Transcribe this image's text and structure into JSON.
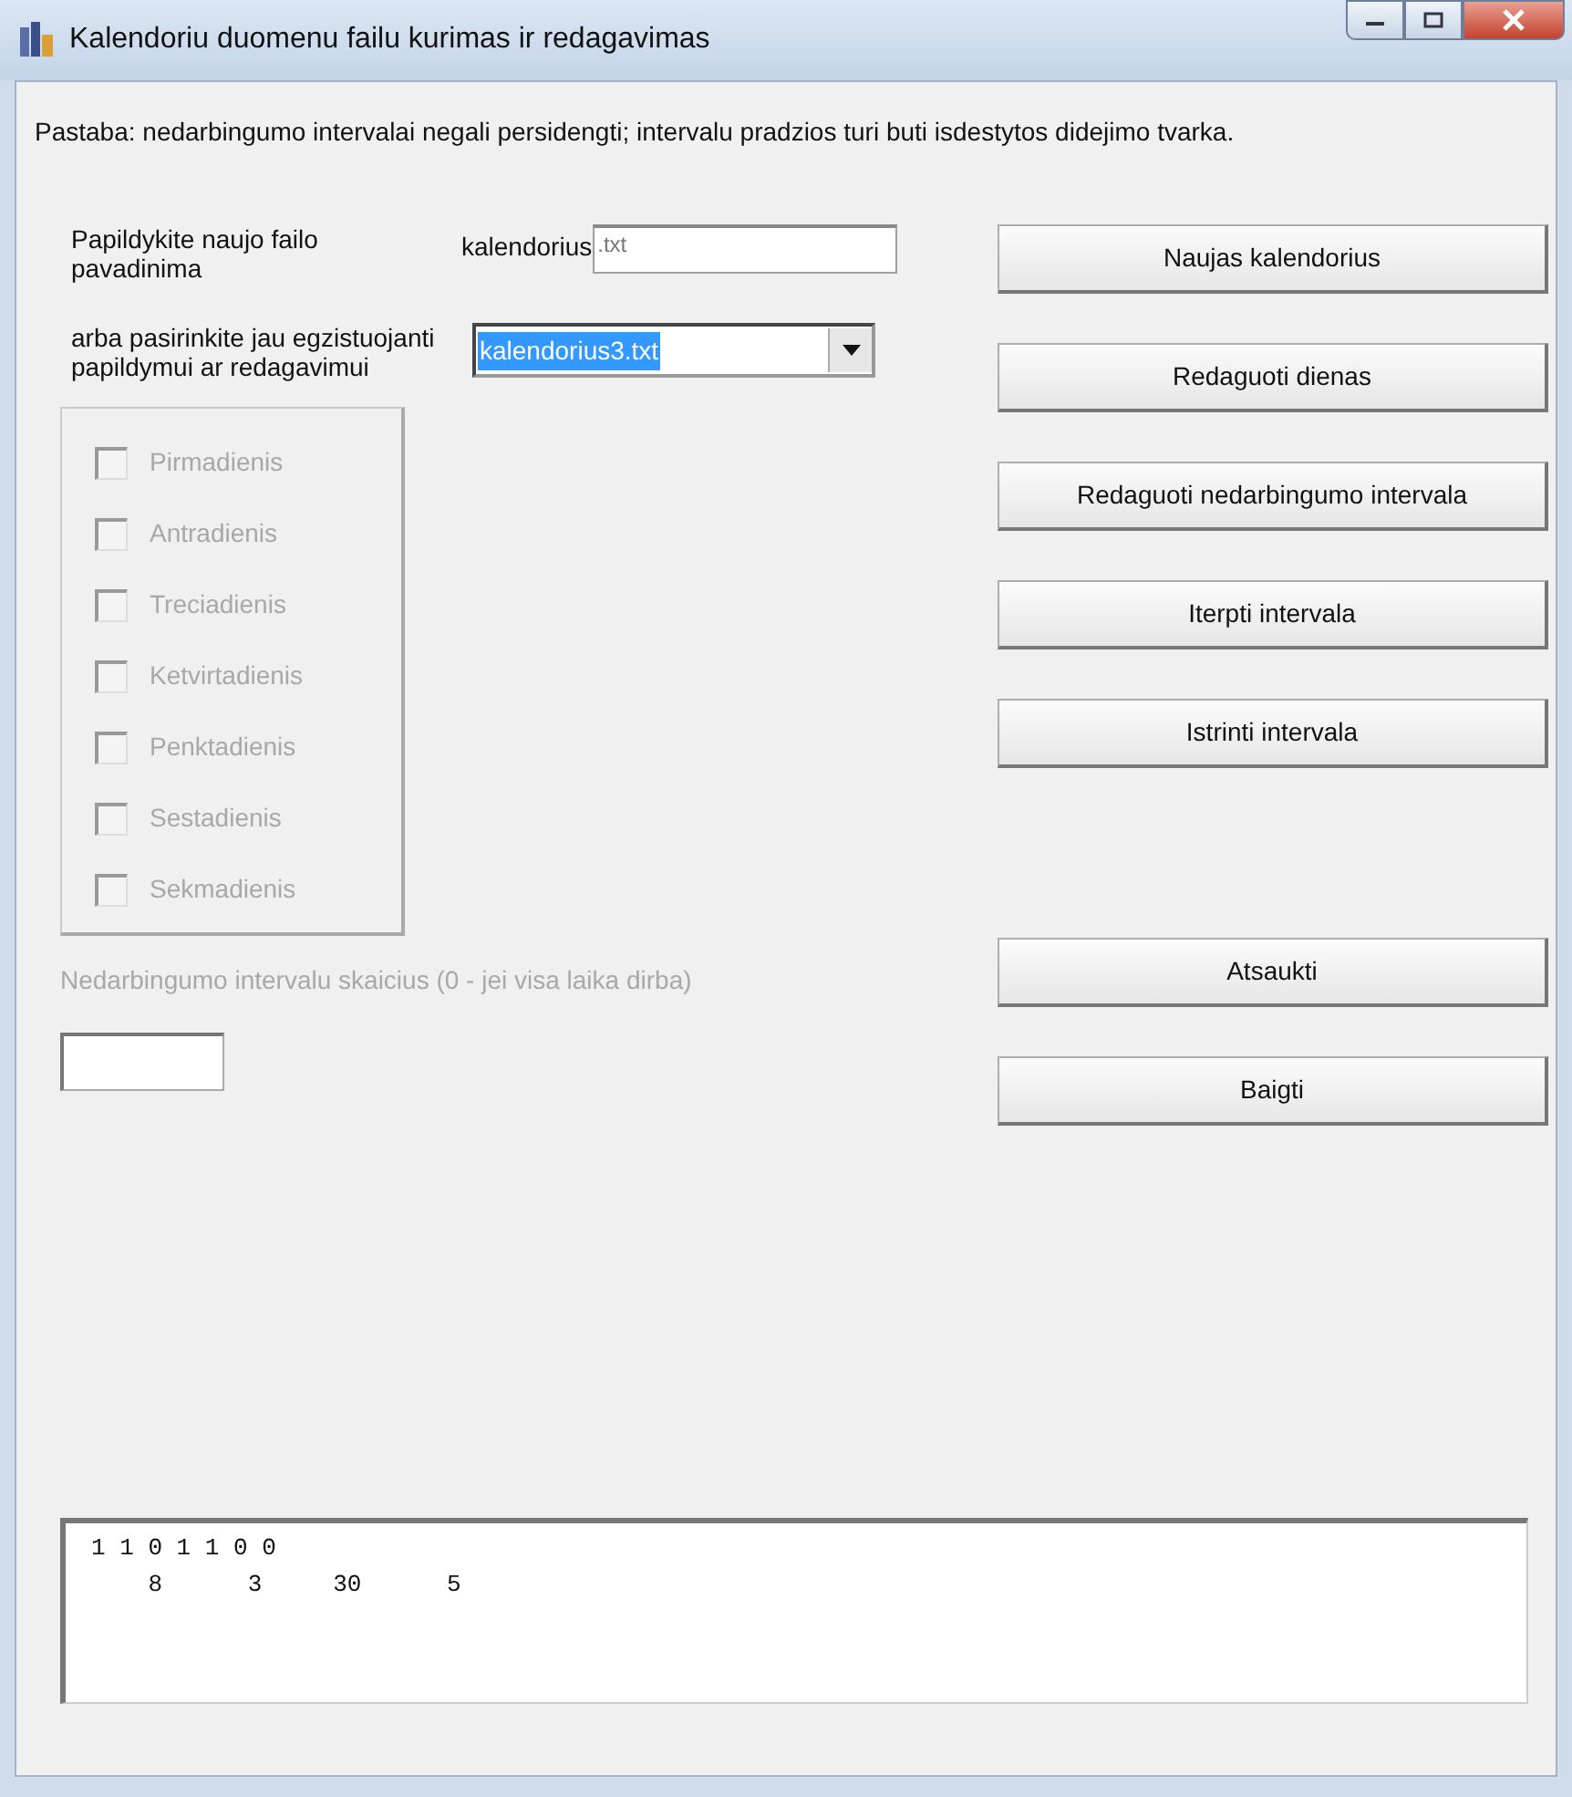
{
  "window": {
    "title": "Kalendoriu duomenu failu kurimas ir redagavimas"
  },
  "note": "Pastaba: nedarbingumo intervalai negali persidengti; intervalu pradzios turi buti isdestytos didejimo tvarka.",
  "new_file": {
    "label": "Papildykite naujo failo pavadinima",
    "prefix": "kalendorius",
    "placeholder": ".txt"
  },
  "existing_file": {
    "label": "arba pasirinkite jau egzistuojanti papildymui ar redagavimui",
    "value": "kalendorius3.txt",
    "highlighted": true
  },
  "days": [
    {
      "label": "Pirmadienis",
      "checked": false,
      "disabled": true
    },
    {
      "label": "Antradienis",
      "checked": false,
      "disabled": true
    },
    {
      "label": "Treciadienis",
      "checked": false,
      "disabled": true
    },
    {
      "label": "Ketvirtadienis",
      "checked": false,
      "disabled": true
    },
    {
      "label": "Penktadienis",
      "checked": false,
      "disabled": true
    },
    {
      "label": "Sestadienis",
      "checked": false,
      "disabled": true
    },
    {
      "label": "Sekmadienis",
      "checked": false,
      "disabled": true
    }
  ],
  "interval_count": {
    "label": "Nedarbingumo intervalu skaicius  (0 - jei visa laika dirba)",
    "disabled": true
  },
  "action_buttons": [
    "Naujas kalendorius",
    "Redaguoti dienas",
    "Redaguoti nedarbingumo intervala",
    "Iterpti intervala",
    "Istrinti intervala"
  ],
  "exit_buttons": [
    "Atsaukti",
    "Baigti"
  ],
  "output_lines": [
    "1 1 0 1 1 0 0",
    "    8      3     30      5"
  ]
}
